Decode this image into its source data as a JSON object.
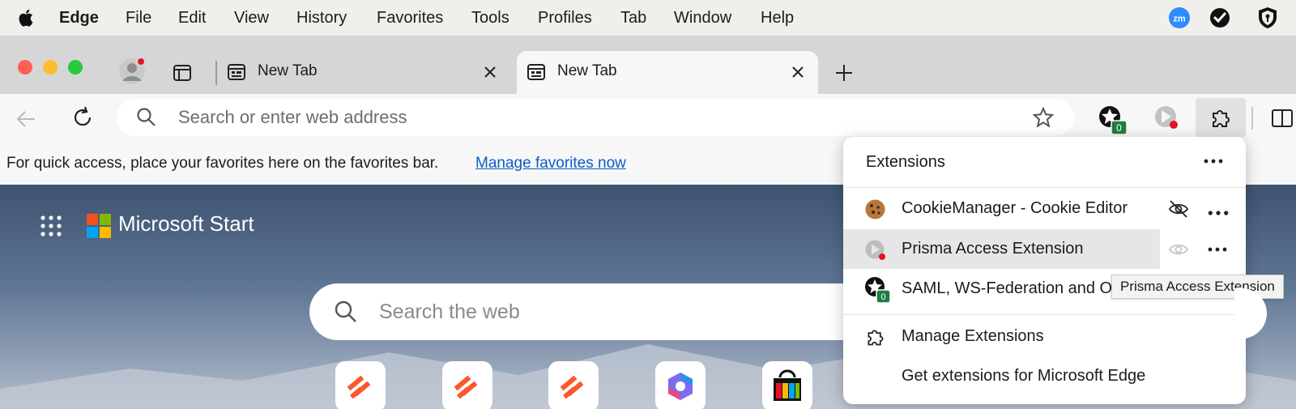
{
  "menubar": {
    "app_name": "Edge",
    "items": [
      "File",
      "Edit",
      "View",
      "History",
      "Favorites",
      "Tools",
      "Profiles",
      "Tab",
      "Window",
      "Help"
    ],
    "tray": {
      "zoom_label": "zm"
    }
  },
  "tabs": [
    {
      "title": "New Tab",
      "active": false
    },
    {
      "title": "New Tab",
      "active": true
    }
  ],
  "toolbar": {
    "address_placeholder": "Search or enter web address",
    "badge_count": "0"
  },
  "favorites_bar": {
    "message": "For quick access, place your favorites here on the favorites bar.",
    "link_label": "Manage favorites now"
  },
  "new_tab_page": {
    "brand": "Microsoft Start",
    "search_placeholder": "Search the web"
  },
  "extensions_popup": {
    "title": "Extensions",
    "extensions": [
      {
        "name": "CookieManager - Cookie Editor",
        "visibility": "hidden"
      },
      {
        "name": "Prisma Access Extension",
        "visibility": "shown"
      },
      {
        "name": "SAML, WS-Federation and OA",
        "badge": "0"
      }
    ],
    "manage_label": "Manage Extensions",
    "get_label": "Get extensions for Microsoft Edge",
    "tooltip": "Prisma Access Extension"
  },
  "colors": {
    "link": "#0b5cc9",
    "badge_green": "#1e7d45",
    "close_red": "#ff5f57",
    "minimize_yellow": "#febc2e",
    "zoom_green": "#28c840"
  }
}
